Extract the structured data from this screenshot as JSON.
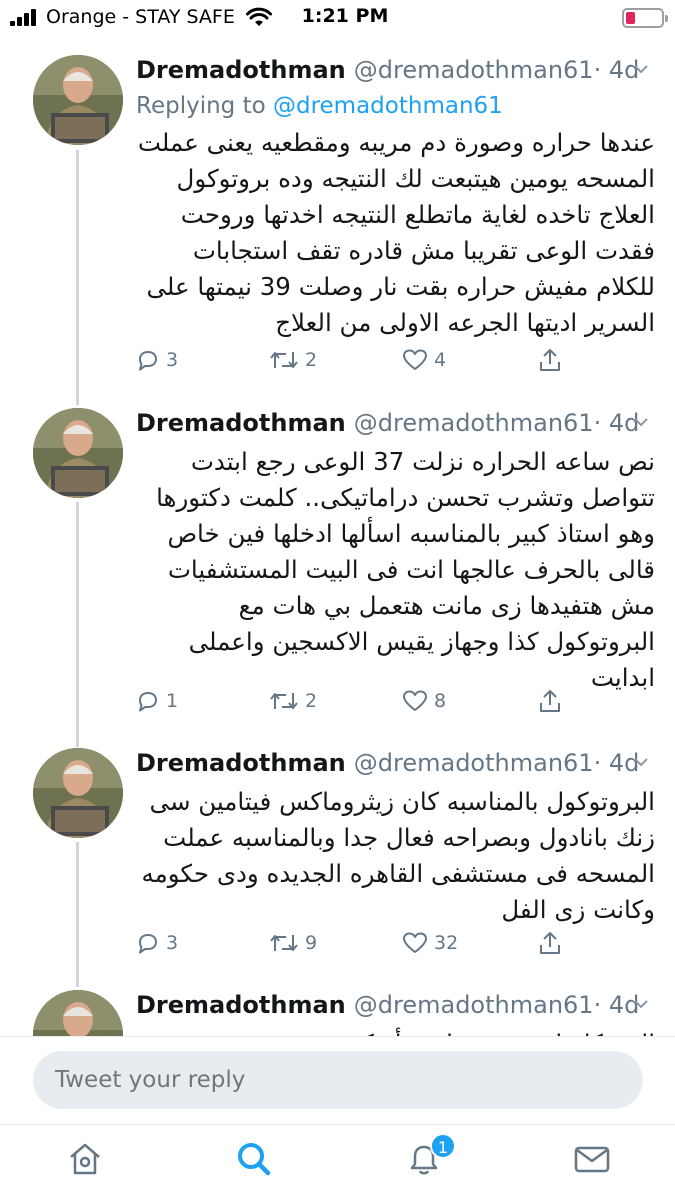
{
  "status_bar": {
    "carrier": "Orange - STAY SAFE",
    "time": "1:21 PM",
    "battery_level": 0.2
  },
  "tweets": [
    {
      "name": "Dremadothman",
      "handle": "@dremadothman61",
      "time": "· 4d",
      "replying_prefix": "Replying to",
      "replying_to": "@dremadothman61",
      "text": "عندها حراره وصورة دم مريبه ومقطعيه يعنى عملت المسحه يومين هيتبعت لك النتيجه وده بروتوكول العلاج تاخده لغاية ماتطلع النتيجه اخدتها وروحت فقدت الوعى تقريبا مش قادره تقف استجابات للكلام مفيش حراره بقت نار وصلت 39 نيمتها على السرير اديتها الجرعه الاولى من العلاج",
      "replies": "3",
      "retweets": "2",
      "likes": "4"
    },
    {
      "name": "Dremadothman",
      "handle": "@dremadothman61",
      "time": "· 4d",
      "text": "نص ساعه الحراره نزلت 37  الوعى رجع ابتدت تتواصل وتشرب تحسن دراماتيكى..  كلمت دكتورها وهو استاذ كبير بالمناسبه اسألها ادخلها فين خاص قالى بالحرف عالجها انت فى البيت المستشفيات مش هتفيدها زى مانت هتعمل بي هات مع البروتوكول كذا وجهاز يقيس الاكسجين واعملى ابدايت",
      "replies": "1",
      "retweets": "2",
      "likes": "8"
    },
    {
      "name": "Dremadothman",
      "handle": "@dremadothman61",
      "time": "· 4d",
      "text": "البروتوكول بالمناسبه كان زيثروماكس فيتامين سى زنك بانادول وبصراحه فعال جدا وبالمناسبه عملت المسحه فى مستشفى القاهره الجديده ودى حكومه وكانت زى الفل",
      "replies": "3",
      "retweets": "9",
      "likes": "32"
    },
    {
      "name": "Dremadothman",
      "handle": "@dremadothman61",
      "time": "· 4d",
      "text": "المشكلة انى مش عارفه أفتكر ...",
      "replies": "",
      "retweets": "",
      "likes": ""
    }
  ],
  "reply": {
    "placeholder": "Tweet your reply"
  },
  "tabbar": {
    "notifications_badge": "1"
  },
  "colors": {
    "accent": "#1da1f2",
    "secondary_text": "#657786",
    "primary_text": "#14171a"
  }
}
